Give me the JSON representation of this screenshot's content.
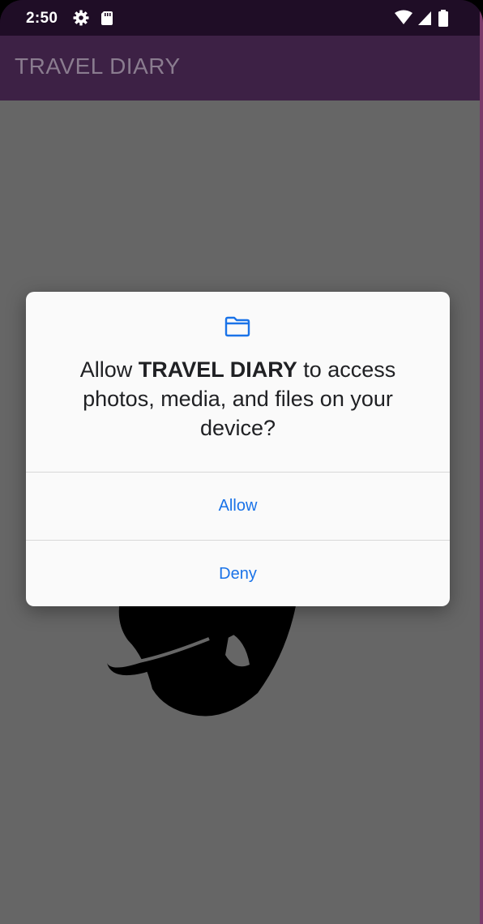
{
  "status_bar": {
    "time": "2:50",
    "icons": [
      "gear-icon",
      "sd-card-icon",
      "wifi-icon",
      "cell-signal-icon",
      "battery-icon"
    ]
  },
  "app_bar": {
    "title": "TRAVEL DIARY"
  },
  "dialog": {
    "icon": "folder-icon",
    "message_prefix": "Allow ",
    "message_app": "TRAVEL DIARY",
    "message_suffix": " to access photos, media, and files on your device?",
    "allow_label": "Allow",
    "deny_label": "Deny"
  },
  "colors": {
    "status_bar": "#1f0d26",
    "app_bar": "#3d2145",
    "scrim": "#666666",
    "dialog_bg": "#fafafa",
    "accent": "#1a73e8"
  }
}
